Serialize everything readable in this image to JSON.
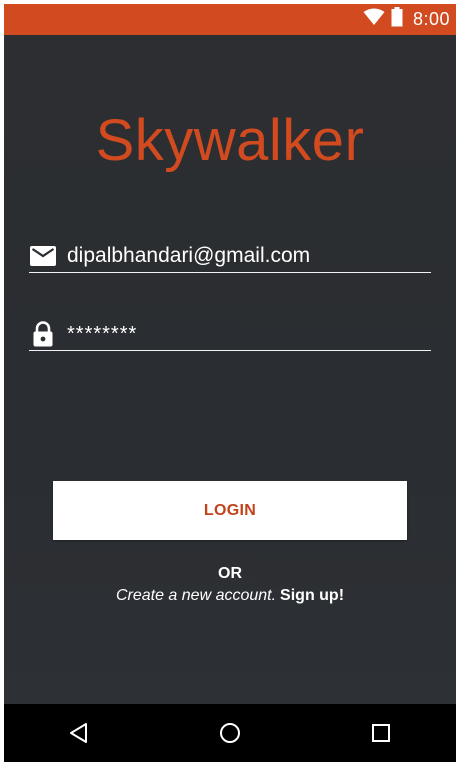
{
  "status_bar": {
    "time": "8:00",
    "icons": [
      "wifi-icon",
      "battery-icon"
    ],
    "color": "#d24a1f"
  },
  "app": {
    "title": "Skywalker",
    "accent_color": "#d24a1f"
  },
  "form": {
    "email": {
      "icon": "mail-icon",
      "value": "dipalbhandari@gmail.com"
    },
    "password": {
      "icon": "lock-icon",
      "value": "********"
    },
    "login_label": "LOGIN"
  },
  "footer": {
    "or_label": "OR",
    "signup_prompt": "Create a new account.",
    "signup_link": "Sign up!"
  },
  "nav_bar": {
    "buttons": [
      "back-icon",
      "home-icon",
      "recents-icon"
    ]
  }
}
